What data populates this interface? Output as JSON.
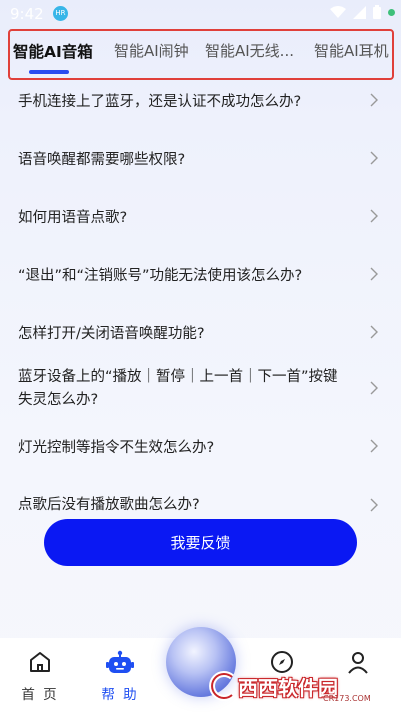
{
  "status_bar": {
    "time": "9:42",
    "app_icon_text": "HR"
  },
  "tabs": [
    {
      "label": "智能AI音箱",
      "active": true
    },
    {
      "label": "智能AI闹钟",
      "active": false
    },
    {
      "label": "智能AI无线...",
      "active": false
    },
    {
      "label": "智能AI耳机",
      "active": false
    }
  ],
  "faq": [
    {
      "question": "手机连接上了蓝牙，还是认证不成功怎么办?"
    },
    {
      "question": "语音唤醒都需要哪些权限?"
    },
    {
      "question": "如何用语音点歌?"
    },
    {
      "question": "“退出”和“注销账号”功能无法使用该怎么办?"
    },
    {
      "question": "怎样打开/关闭语音唤醒功能?"
    },
    {
      "question": "蓝牙设备上的“播放｜暂停｜上一首｜下一首”按键失灵怎么办?"
    },
    {
      "question": "灯光控制等指令不生效怎么办?"
    },
    {
      "question": "点歌后没有播放歌曲怎么办?"
    }
  ],
  "feedback_button": {
    "label": "我要反馈"
  },
  "bottom_nav": {
    "home_label": "首 页",
    "help_label": "帮 助"
  },
  "watermark": {
    "text": "西西软件园",
    "url": "CR173.COM"
  },
  "colors": {
    "accent": "#0a18f3",
    "tab_indicator": "#2a4df0",
    "highlight_frame": "#e0403a",
    "active_nav": "#1f4ff2"
  }
}
